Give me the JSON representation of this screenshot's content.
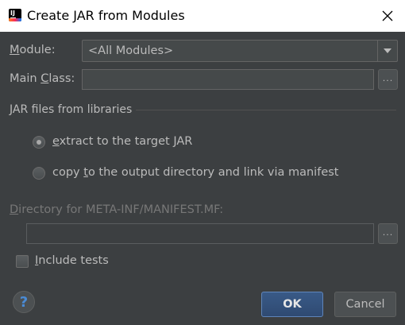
{
  "window": {
    "title": "Create JAR from Modules",
    "icon": "intellij-idea-icon",
    "close_icon": "close-icon"
  },
  "module": {
    "label_prefix": "",
    "label_mnemonic": "M",
    "label_rest": "odule:",
    "value": "<All Modules>"
  },
  "main_class": {
    "label_prefix": "Main ",
    "label_mnemonic": "C",
    "label_rest": "lass:",
    "value": "",
    "browse_label": "..."
  },
  "libraries": {
    "section_title": "JAR files from libraries",
    "options": [
      {
        "mnemonic": "e",
        "rest": "xtract to the target JAR",
        "selected": true
      },
      {
        "prefix": "copy ",
        "mnemonic": "t",
        "rest": "o the output directory and link via manifest",
        "selected": false
      }
    ]
  },
  "manifest": {
    "label_mnemonic": "D",
    "label_rest": "irectory for META-INF/MANIFEST.MF:",
    "value": "",
    "browse_label": "..."
  },
  "include_tests": {
    "mnemonic": "I",
    "rest": "nclude tests",
    "checked": false
  },
  "buttons": {
    "help": "?",
    "ok": "OK",
    "cancel": "Cancel"
  },
  "colors": {
    "background": "#3c3f41",
    "text": "#bbbbbb",
    "disabled_text": "#777777",
    "ok_button": "#365880",
    "help_icon": "#4a8bd5"
  }
}
